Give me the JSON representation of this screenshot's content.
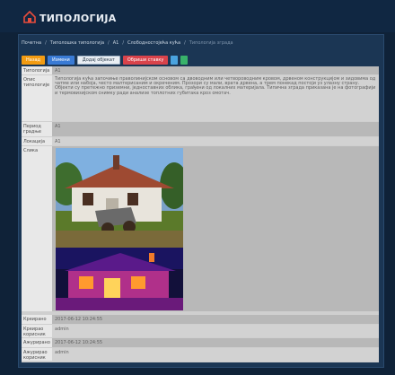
{
  "app": {
    "title": "ТИПОЛОГИЈА"
  },
  "breadcrumb": {
    "items": [
      "Почетна",
      "Типолошка типологија",
      "А1",
      "Слободностојећа кућа",
      "Типологија зграда"
    ]
  },
  "toolbar": {
    "buttons": [
      {
        "label": "Назад",
        "color": "#f39c12"
      },
      {
        "label": "Измени",
        "color": "#3a7bd5"
      },
      {
        "label": "Додај објекат",
        "color": "#e9eef4"
      },
      {
        "label": "Обриши ставку",
        "color": "#d9434b"
      }
    ]
  },
  "fields": [
    {
      "label": "Типологија",
      "value": "А1"
    },
    {
      "label": "Опис типологије",
      "value": "Типологија кућа започиње праволинијском основом са двоводним или четвороводним кровом, дрвеном конструкцијом и зидовима од чатме или набоја, често малтерисаним и окреченим. Прозори су мали, врата дрвена, а трем понекад постоји уз улазну страну. Објекти су претежно приземни, једноставних облика, грађени од локалних материјала. Типична зграда приказана је на фотографији и термовизијском снимку ради анализе топлотних губитака кроз омотач."
    },
    {
      "label": "Период градње",
      "value": "А1"
    },
    {
      "label": "Локација",
      "value": "А1"
    },
    {
      "label": "Слика",
      "value": ""
    },
    {
      "label": "Креирано",
      "value": "2017-06-12 10:24:55"
    },
    {
      "label": "Креирао корисник",
      "value": "admin"
    },
    {
      "label": "Ажурирано",
      "value": "2017-06-12 10:24:55"
    },
    {
      "label": "Ажурирао корисник",
      "value": "admin"
    }
  ]
}
